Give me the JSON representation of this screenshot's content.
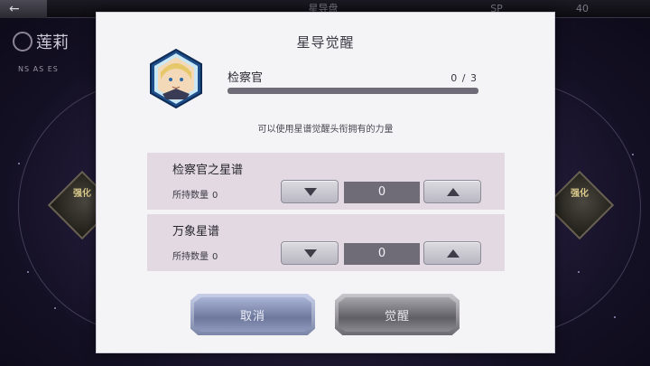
{
  "background": {
    "back_icon": "←",
    "tab_center": "星导盘",
    "tab_right": "SP",
    "tab_value": "40",
    "character_name": "莲莉",
    "stat_row": "NS AS ES",
    "left_button_label": "强化",
    "right_button_label": "强化"
  },
  "dialog": {
    "title": "星导觉醒",
    "rank": {
      "name": "检察官",
      "count": "0 / 3",
      "progress_fraction": 0.0
    },
    "description": "可以使用星谱觉醒头衔拥有的力量",
    "items": [
      {
        "name": "检察官之星谱",
        "owned_label": "所持数量",
        "owned_value": "0",
        "quantity": "0"
      },
      {
        "name": "万象星谱",
        "owned_label": "所持数量",
        "owned_value": "0",
        "quantity": "0"
      }
    ],
    "cancel_label": "取消",
    "awaken_label": "觉醒"
  },
  "colors": {
    "dialog_bg": "#f4f3f6",
    "item_bg": "#e2d9e3",
    "progress_track": "#6f6c78",
    "qty_bg": "#6f6c78",
    "cancel_button": "#8f9abe",
    "awaken_button": "#8b8a91"
  },
  "icons": [
    "back-arrow-icon",
    "character-portrait-icon",
    "arrow-down-icon",
    "arrow-up-icon"
  ]
}
